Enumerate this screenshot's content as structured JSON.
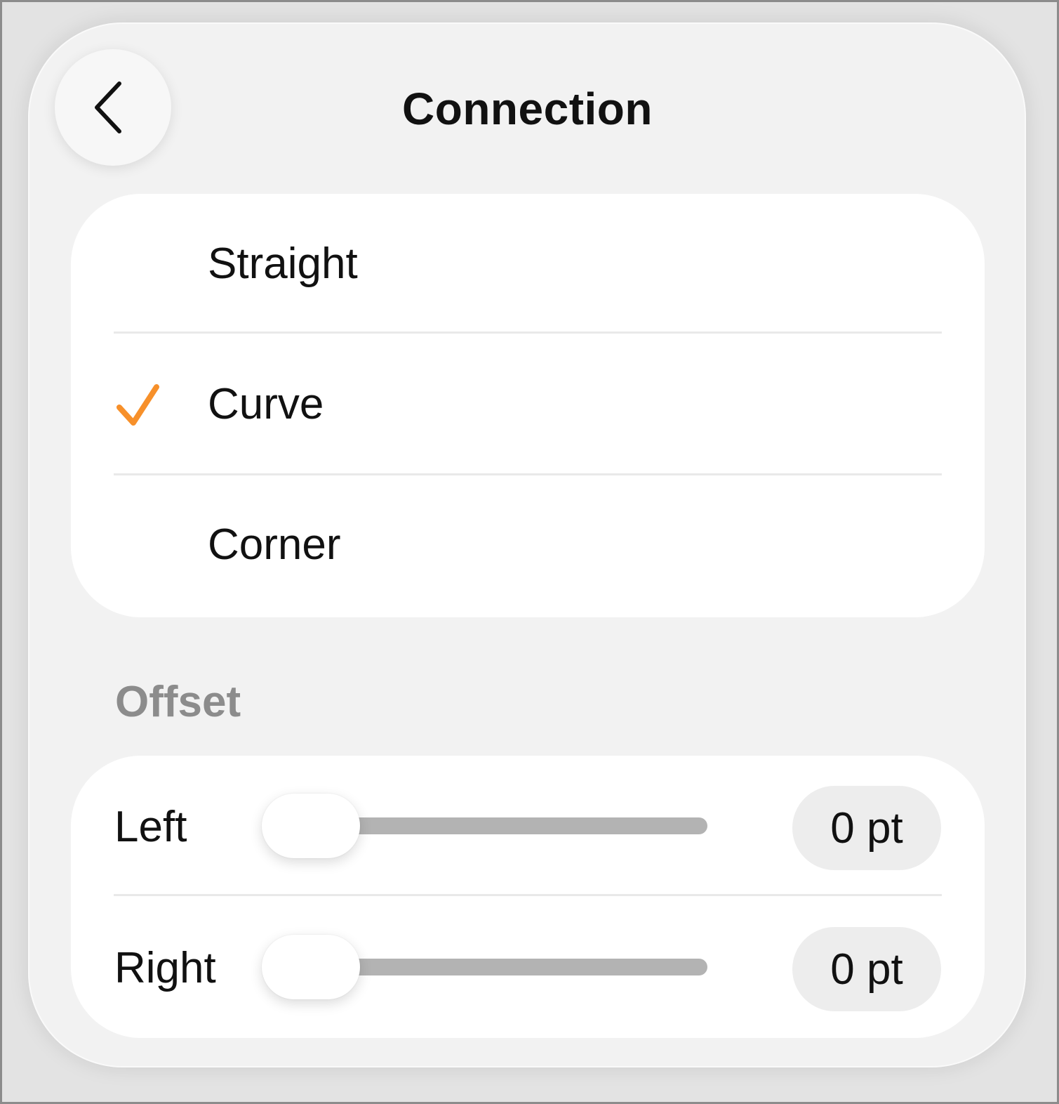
{
  "header": {
    "title": "Connection",
    "back_icon": "chevron-left-icon"
  },
  "connection_types": {
    "items": [
      {
        "label": "Straight",
        "selected": false
      },
      {
        "label": "Curve",
        "selected": true
      },
      {
        "label": "Corner",
        "selected": false
      }
    ],
    "check_icon": "checkmark-icon",
    "accent_color": "#F7902A"
  },
  "offset": {
    "section_label": "Offset",
    "left": {
      "label": "Left",
      "value_text": "0 pt",
      "value": 0
    },
    "right": {
      "label": "Right",
      "value_text": "0 pt",
      "value": 0
    }
  }
}
